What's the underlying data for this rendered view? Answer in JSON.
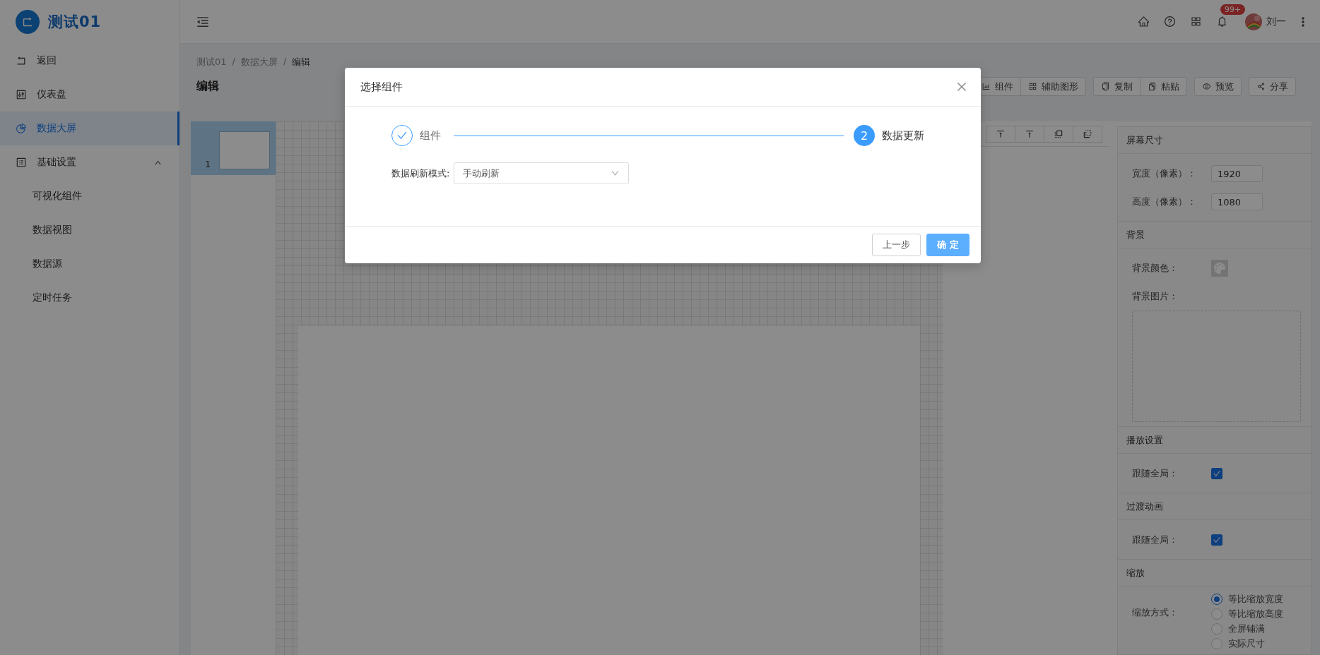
{
  "sidebar": {
    "logo_text": "测试01",
    "items": [
      {
        "label": "返回",
        "selected": false
      },
      {
        "label": "仪表盘",
        "selected": false
      },
      {
        "label": "数据大屏",
        "selected": true
      },
      {
        "label": "基础设置",
        "selected": false,
        "expanded": true,
        "children": [
          {
            "label": "可视化组件",
            "selected": false
          },
          {
            "label": "数据视图",
            "selected": false
          },
          {
            "label": "数据源",
            "selected": false
          },
          {
            "label": "定时任务",
            "selected": false
          }
        ]
      }
    ]
  },
  "header": {
    "notification_count": "99+",
    "user_name": "刘一"
  },
  "breadcrumb": {
    "items": [
      "测试01",
      "数据大屏",
      "编辑"
    ],
    "separators": [
      "/",
      "/"
    ]
  },
  "page_title": "编辑",
  "toolbar": [
    [
      {
        "label": "组件"
      },
      {
        "label": "辅助图形"
      }
    ],
    [
      {
        "label": "复制"
      },
      {
        "label": "粘贴"
      }
    ],
    [
      {
        "label": "预览"
      }
    ],
    [
      {
        "label": "分享"
      }
    ]
  ],
  "thumbnails": [
    {
      "number": "1",
      "selected": true
    }
  ],
  "right_panel": {
    "sections": [
      {
        "title": "屏幕尺寸",
        "fields": [
          {
            "kind": "input",
            "label": "宽度（像素）：",
            "value": "1920"
          },
          {
            "kind": "input",
            "label": "高度（像素）：",
            "value": "1080"
          }
        ]
      },
      {
        "title": "背景",
        "fields": [
          {
            "kind": "color",
            "label": "背景颜色："
          },
          {
            "kind": "upload",
            "label": "背景图片："
          }
        ]
      },
      {
        "title": "播放设置",
        "fields": [
          {
            "kind": "checkbox",
            "label": "跟随全局：",
            "checked": true
          }
        ]
      },
      {
        "title": "过渡动画",
        "fields": [
          {
            "kind": "checkbox",
            "label": "跟随全局：",
            "checked": true
          }
        ]
      },
      {
        "title": "缩放",
        "fields": [
          {
            "kind": "radio",
            "label": "缩放方式：",
            "options": [
              {
                "label": "等比缩放宽度",
                "selected": true
              },
              {
                "label": "等比缩放高度",
                "selected": false
              },
              {
                "label": "全屏铺满",
                "selected": false
              },
              {
                "label": "实际尺寸",
                "selected": false
              }
            ]
          }
        ]
      }
    ]
  },
  "modal": {
    "title": "选择组件",
    "steps": [
      {
        "label": "组件",
        "completed": true
      },
      {
        "number": "2",
        "label": "数据更新",
        "completed": false
      }
    ],
    "form": {
      "label": "数据刷新模式:",
      "value": "手动刷新"
    },
    "buttons": [
      {
        "label": "上一步",
        "kind": "default"
      },
      {
        "label": "确 定",
        "kind": "primary"
      }
    ]
  }
}
